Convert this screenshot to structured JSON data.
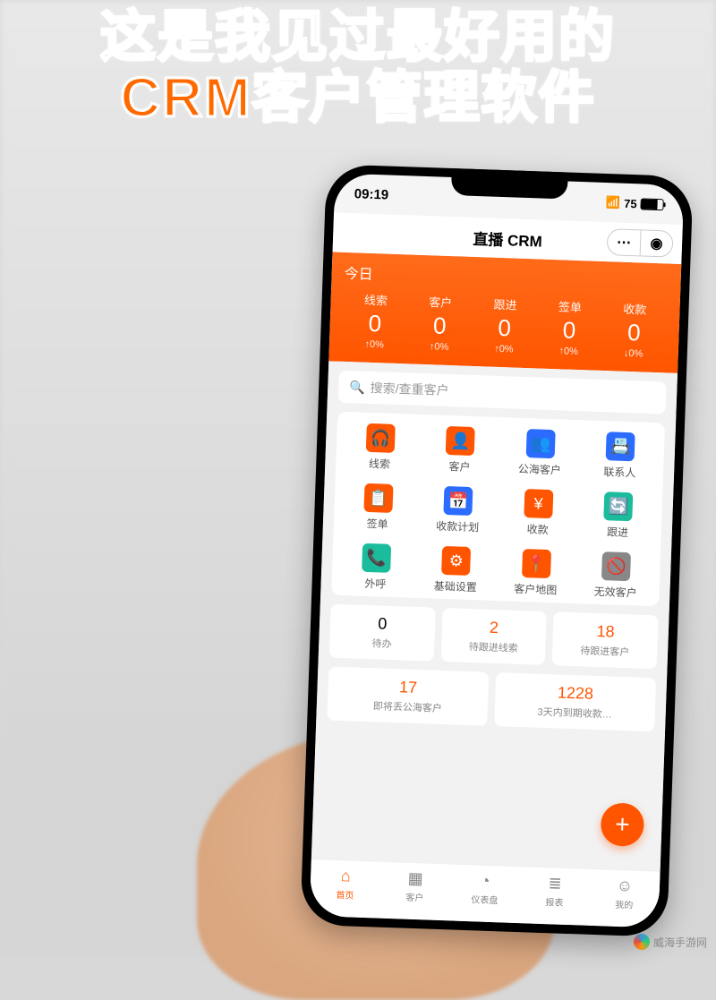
{
  "overlay": {
    "line1": "这是我见过最好用的",
    "line2": "CRM客户管理软件"
  },
  "statusbar": {
    "time": "09:19",
    "battery": "75"
  },
  "navbar": {
    "title": "直播 CRM"
  },
  "today_panel": {
    "label": "今日",
    "stats": [
      {
        "label": "线索",
        "value": "0",
        "delta": "↑0%"
      },
      {
        "label": "客户",
        "value": "0",
        "delta": "↑0%"
      },
      {
        "label": "跟进",
        "value": "0",
        "delta": "↑0%"
      },
      {
        "label": "签单",
        "value": "0",
        "delta": "↑0%"
      },
      {
        "label": "收款",
        "value": "0",
        "delta": "↓0%"
      }
    ]
  },
  "search": {
    "placeholder": "搜索/查重客户"
  },
  "menu": [
    {
      "label": "线索",
      "color": "#ff5500",
      "glyph": "🎧"
    },
    {
      "label": "客户",
      "color": "#ff5500",
      "glyph": "👤"
    },
    {
      "label": "公海客户",
      "color": "#2b6cff",
      "glyph": "👥"
    },
    {
      "label": "联系人",
      "color": "#2b6cff",
      "glyph": "📇"
    },
    {
      "label": "签单",
      "color": "#ff5500",
      "glyph": "📋"
    },
    {
      "label": "收款计划",
      "color": "#2b6cff",
      "glyph": "📅"
    },
    {
      "label": "收款",
      "color": "#ff5500",
      "glyph": "¥"
    },
    {
      "label": "跟进",
      "color": "#1abc9c",
      "glyph": "🔄"
    },
    {
      "label": "外呼",
      "color": "#1abc9c",
      "glyph": "📞"
    },
    {
      "label": "基础设置",
      "color": "#ff5500",
      "glyph": "⚙"
    },
    {
      "label": "客户地图",
      "color": "#ff5500",
      "glyph": "📍"
    },
    {
      "label": "无效客户",
      "color": "#888888",
      "glyph": "🚫"
    }
  ],
  "cards": [
    {
      "num": "0",
      "orange": false,
      "label": "待办"
    },
    {
      "num": "2",
      "orange": true,
      "label": "待跟进线索"
    },
    {
      "num": "18",
      "orange": true,
      "label": "待跟进客户"
    }
  ],
  "cards2": [
    {
      "num": "17",
      "orange": true,
      "label": "即将丢公海客户"
    },
    {
      "num": "1228",
      "orange": true,
      "label": "3天内到期收款…"
    }
  ],
  "tabs": [
    {
      "label": "首页",
      "icon": "⌂",
      "active": true
    },
    {
      "label": "客户",
      "icon": "▦",
      "active": false
    },
    {
      "label": "仪表盘",
      "icon": "◔",
      "active": false
    },
    {
      "label": "报表",
      "icon": "≣",
      "active": false
    },
    {
      "label": "我的",
      "icon": "☺",
      "active": false
    }
  ],
  "watermark": "威海手游网"
}
